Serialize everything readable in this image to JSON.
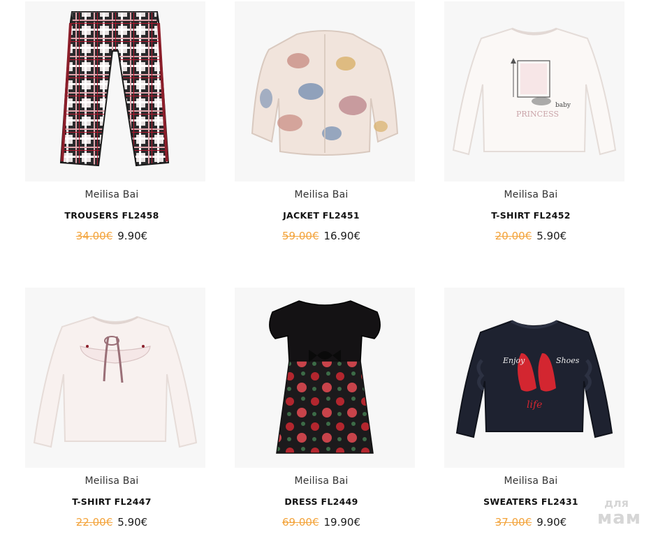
{
  "products": [
    {
      "brand": "Meilisa Bai",
      "title": "TROUSERS FL2458",
      "old_price": "34.00€",
      "price": "9.90€",
      "image": "plaid-trousers"
    },
    {
      "brand": "Meilisa Bai",
      "title": "JACKET FL2451",
      "old_price": "59.00€",
      "price": "16.90€",
      "image": "floral-fur-jacket"
    },
    {
      "brand": "Meilisa Bai",
      "title": "T-SHIRT FL2452",
      "old_price": "20.00€",
      "price": "5.90€",
      "image": "princess-longsleeve-tshirt"
    },
    {
      "brand": "Meilisa Bai",
      "title": "T-SHIRT FL2447",
      "old_price": "22.00€",
      "price": "5.90€",
      "image": "bow-longsleeve-tshirt"
    },
    {
      "brand": "Meilisa Bai",
      "title": "DRESS FL2449",
      "old_price": "69.00€",
      "price": "19.90€",
      "image": "velvet-floral-dress"
    },
    {
      "brand": "Meilisa Bai",
      "title": "SWEATERS FL2431",
      "old_price": "37.00€",
      "price": "9.90€",
      "image": "navy-shoes-sweater"
    }
  ],
  "image_texts": {
    "tshirt_1_top": "baby",
    "tshirt_1_bottom": "PRINCESS",
    "sweater_1": "Enjoy",
    "sweater_2": "Shoes",
    "sweater_3": "life"
  },
  "watermark": {
    "small": "для",
    "big": "мам"
  },
  "colors": {
    "old_price": "#f3a33a",
    "new_price": "#1a1a1a",
    "image_bg": "#f7f7f7"
  }
}
